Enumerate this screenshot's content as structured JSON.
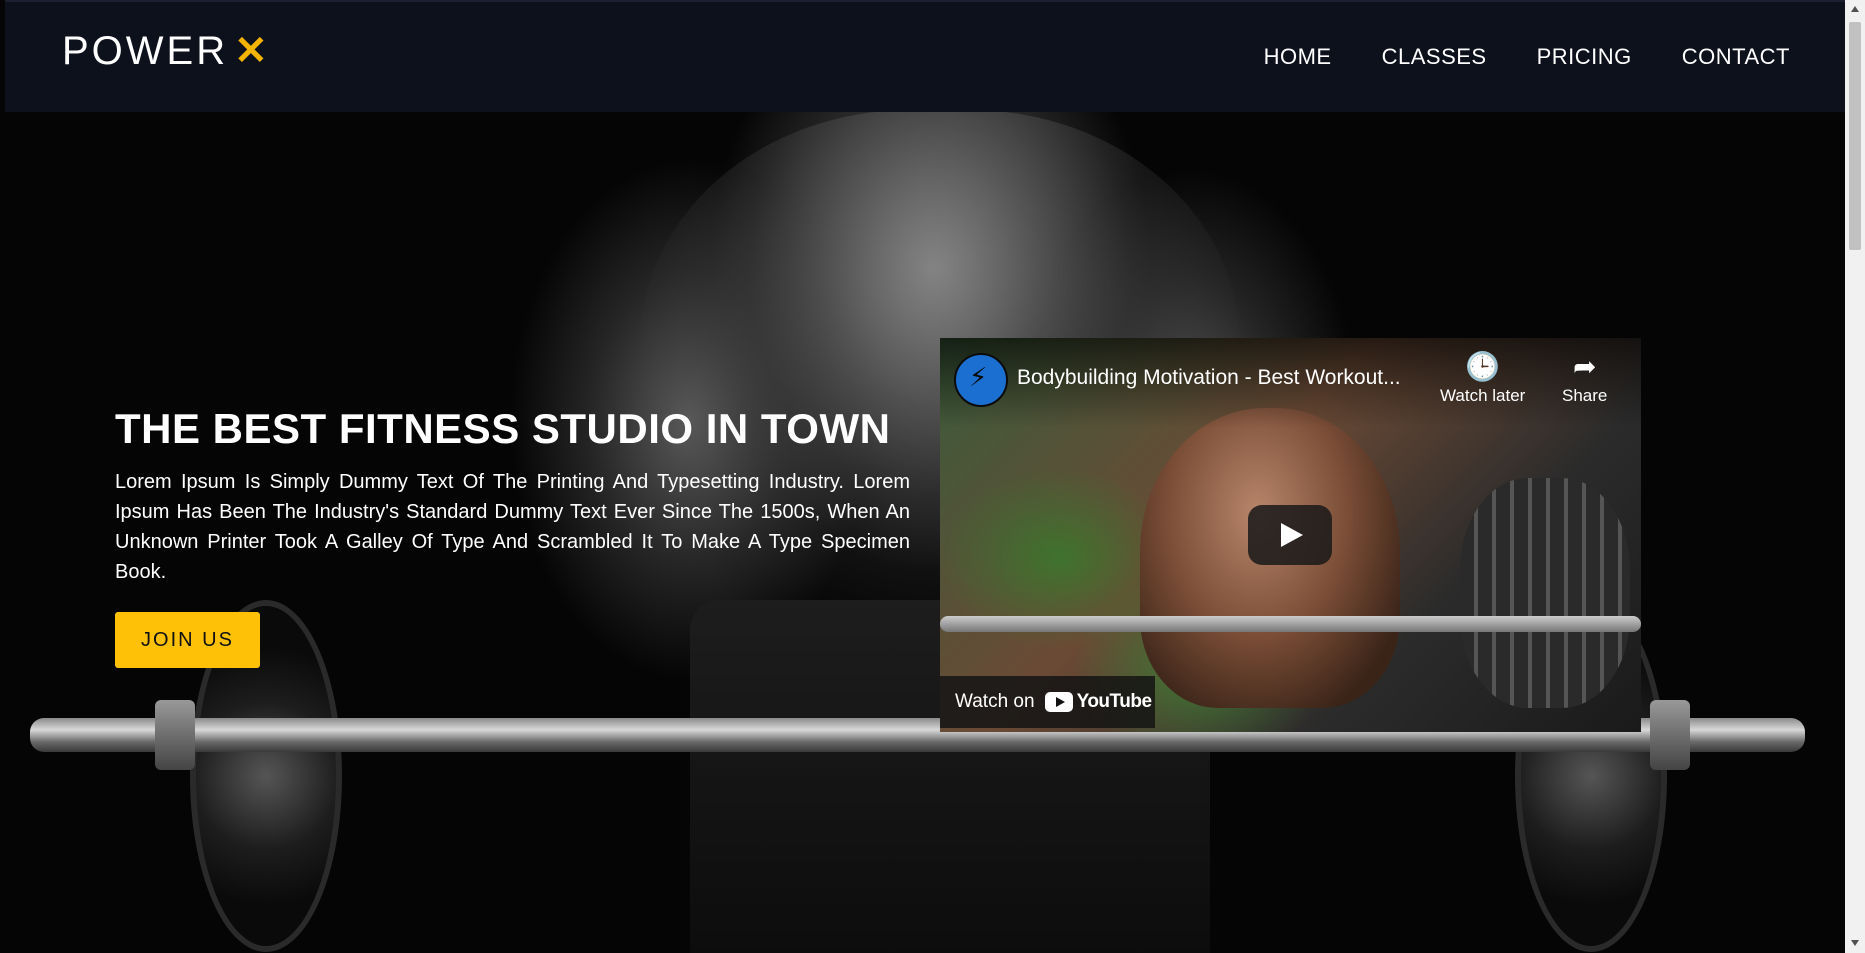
{
  "nav": {
    "logo_text": "POWER",
    "logo_mark": "✕",
    "links": [
      "HOME",
      "CLASSES",
      "PRICING",
      "CONTACT"
    ]
  },
  "hero": {
    "title": "THE BEST FITNESS STUDIO IN TOWN",
    "description": "Lorem Ipsum Is Simply Dummy Text Of The Printing And Typesetting Industry. Lorem Ipsum Has Been The Industry's Standard Dummy Text Ever Since The 1500s, When An Unknown Printer Took A Galley Of Type And Scrambled It To Make A Type Specimen Book.",
    "cta_label": "JOIN US"
  },
  "video": {
    "title": "Bodybuilding Motivation - Best Workout...",
    "watch_later_label": "Watch later",
    "share_label": "Share",
    "watch_on_label": "Watch on",
    "platform_label": "YouTube"
  },
  "colors": {
    "accent": "#ffc107",
    "navbar_bg": "#0d111c"
  }
}
